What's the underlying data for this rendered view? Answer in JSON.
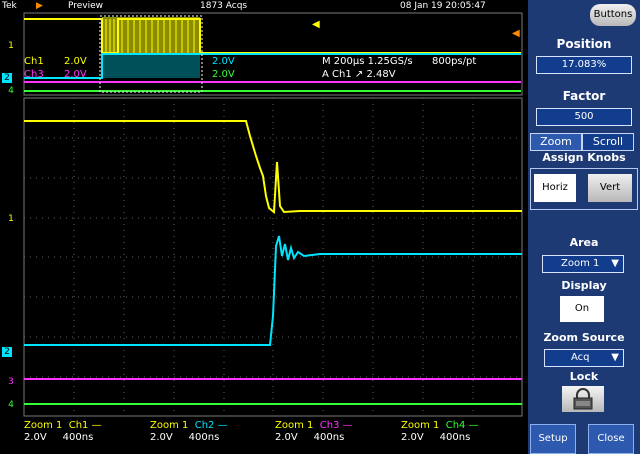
{
  "top_bar": {
    "brand": "Tek",
    "mode": "Preview",
    "acqs": "1873 Acqs",
    "datetime": "08 Jan 19 20:05:47"
  },
  "overview": {
    "ch1": "Ch1",
    "ch1_scale": "2.0V",
    "ch2_scale": "2.0V",
    "ch3": "Ch3",
    "ch3_scale": "2.0V",
    "ch4_scale": "2.0V",
    "timebase": "M 200µs 1.25GS/s",
    "resolution": "800ps/pt",
    "trigger": "A  Ch1  ↗  2.48V"
  },
  "markers": {
    "ch1": "1",
    "ch2": "2",
    "ch3": "3",
    "ch4": "4"
  },
  "bottom": {
    "zoom_label": "Zoom 1",
    "ch1_label": "Ch1 —",
    "ch2_label": "Ch2 —",
    "ch3_label": "Ch3 —",
    "ch4_label": "Ch4 —",
    "volts": "2.0V",
    "time": "400ns"
  },
  "panel": {
    "buttons": "Buttons",
    "position_title": "Position",
    "position_value": "17.083%",
    "factor_title": "Factor",
    "factor_value": "500",
    "tab_zoom": "Zoom",
    "tab_scroll": "Scroll",
    "assign_title": "Assign Knobs",
    "horiz": "Horiz",
    "vert": "Vert",
    "area_title": "Area",
    "area_value": "Zoom 1",
    "display_title": "Display",
    "display_value": "On",
    "zoom_source_title": "Zoom Source",
    "zoom_source_value": "Acq",
    "lock_title": "Lock",
    "setup": "Setup",
    "close": "Close"
  },
  "colors": {
    "ch1": "#ffff00",
    "ch2": "#00e5ff",
    "ch3": "#ff33ff",
    "ch4": "#33ff33",
    "panel_bg": "#1d3a74"
  }
}
